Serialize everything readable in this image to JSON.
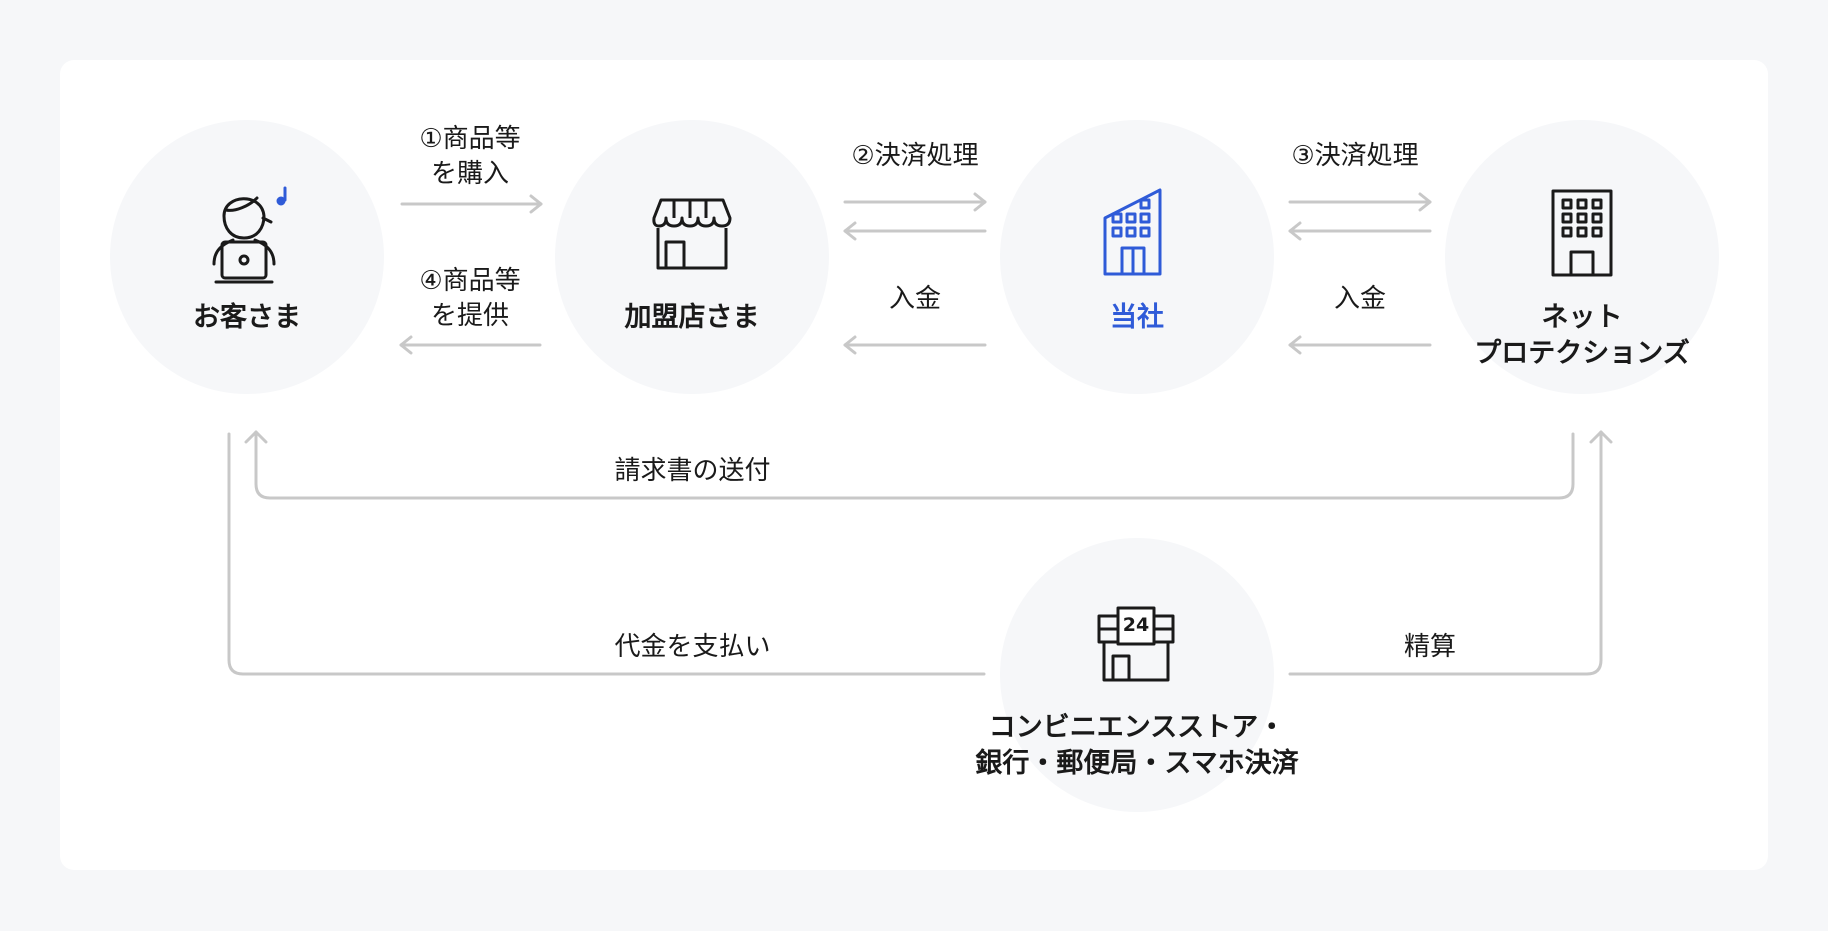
{
  "nodes": {
    "customer": "お客さま",
    "merchant": "加盟店さま",
    "company": "当社",
    "netprotections_line1": "ネット",
    "netprotections_line2": "プロテクションズ",
    "conveni_line1": "コンビニエンスストア・",
    "conveni_line2": "銀行・郵便局・スマホ決済"
  },
  "flows": {
    "step1_line1": "①商品等",
    "step1_line2": "を購入",
    "step4_line1": "④商品等",
    "step4_line2": "を提供",
    "step2": "②決済処理",
    "step3": "③決済処理",
    "deposit_a": "入金",
    "deposit_b": "入金",
    "invoice": "請求書の送付",
    "payment": "代金を支払い",
    "settlement": "精算"
  },
  "icons": {
    "customer": "person-laptop-icon",
    "merchant": "shop-icon",
    "company": "building-icon",
    "netprotections": "office-building-icon",
    "conveni": "convenience-store-24-icon"
  },
  "colors": {
    "accent": "#2f5bd8",
    "arrow": "#c8c8c8",
    "circle": "#f6f7f9"
  },
  "convenience_sign": "24"
}
